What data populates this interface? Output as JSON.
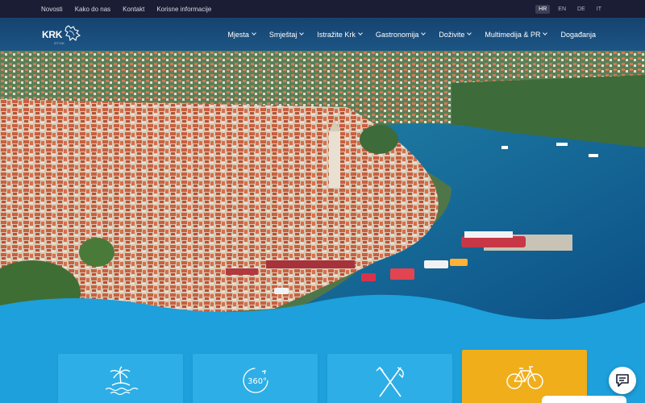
{
  "topbar": {
    "links": [
      "Novosti",
      "Kako do nas",
      "Kontakt",
      "Korisne informacije"
    ],
    "languages": [
      "HR",
      "EN",
      "DE",
      "IT"
    ],
    "active_language": "HR"
  },
  "logo": {
    "text": "KRK",
    "subtitle": "OTOK"
  },
  "nav": {
    "items": [
      {
        "label": "Mjesta",
        "has_dropdown": true
      },
      {
        "label": "Smještaj",
        "has_dropdown": true
      },
      {
        "label": "Istražite Krk",
        "has_dropdown": true
      },
      {
        "label": "Gastronomija",
        "has_dropdown": true
      },
      {
        "label": "Doživite",
        "has_dropdown": true
      },
      {
        "label": "Multimedija & PR",
        "has_dropdown": true
      },
      {
        "label": "Događanja",
        "has_dropdown": false
      }
    ]
  },
  "hero": {
    "image": "aerial view of Krk town and harbour"
  },
  "cards": [
    {
      "icon": "island-palm-icon",
      "active": false
    },
    {
      "icon": "360-view-icon",
      "active": false
    },
    {
      "icon": "fork-knife-icon",
      "active": false
    },
    {
      "icon": "bicycle-icon",
      "active": true
    }
  ],
  "colors": {
    "topbar": "#1a1d33",
    "navbar": "#1c5585",
    "sea": "#1da0dc",
    "card": "#2eaee6",
    "card_active": "#f0ae1b"
  },
  "chat": {
    "icon": "chat-bubble-icon"
  }
}
